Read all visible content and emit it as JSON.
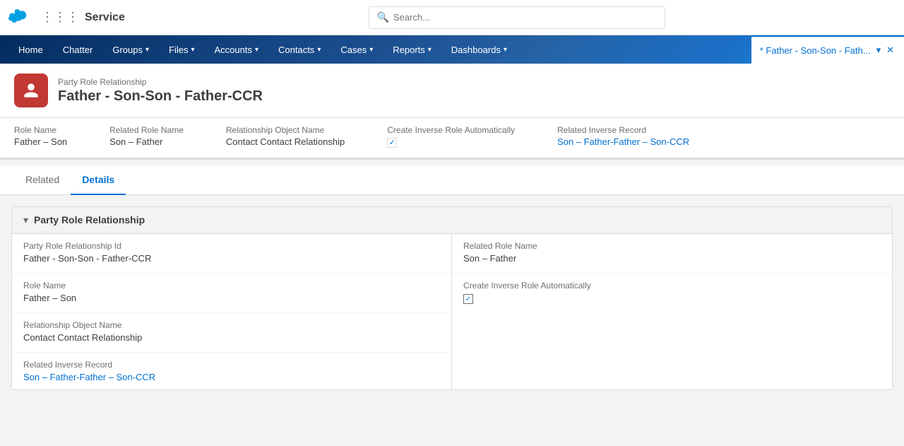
{
  "topNav": {
    "appName": "Service",
    "search": {
      "placeholder": "Search..."
    }
  },
  "navMenu": {
    "items": [
      {
        "label": "Home",
        "hasChevron": false
      },
      {
        "label": "Chatter",
        "hasChevron": false
      },
      {
        "label": "Groups",
        "hasChevron": true
      },
      {
        "label": "Files",
        "hasChevron": true
      },
      {
        "label": "Accounts",
        "hasChevron": true
      },
      {
        "label": "Contacts",
        "hasChevron": true
      },
      {
        "label": "Cases",
        "hasChevron": true
      },
      {
        "label": "Reports",
        "hasChevron": true
      },
      {
        "label": "Dashboards",
        "hasChevron": true
      }
    ],
    "activeTab": "* Father - Son-Son - Fath..."
  },
  "pageHeader": {
    "breadcrumb": "Party Role Relationship",
    "title": "Father - Son-Son - Father-CCR"
  },
  "infoBar": {
    "fields": [
      {
        "label": "Role Name",
        "value": "Father – Son",
        "type": "text"
      },
      {
        "label": "Related Role Name",
        "value": "Son – Father",
        "type": "text"
      },
      {
        "label": "Relationship Object Name",
        "value": "Contact Contact Relationship",
        "type": "text"
      },
      {
        "label": "Create Inverse Role Automatically",
        "value": "checked",
        "type": "checkbox"
      },
      {
        "label": "Related Inverse Record",
        "value": "Son – Father-Father – Son-CCR",
        "type": "link"
      }
    ]
  },
  "tabs": [
    {
      "label": "Related",
      "active": false
    },
    {
      "label": "Details",
      "active": true
    }
  ],
  "section": {
    "title": "Party Role Relationship",
    "fields": [
      {
        "label": "Party Role Relationship Id",
        "value": "Father - Son-Son - Father-CCR",
        "type": "text",
        "editable": false,
        "column": "left"
      },
      {
        "label": "Related Role Name",
        "value": "Son – Father",
        "type": "text",
        "editable": true,
        "column": "right"
      },
      {
        "label": "Role Name",
        "value": "Father – Son",
        "type": "text",
        "editable": true,
        "column": "left"
      },
      {
        "label": "Create Inverse Role Automatically",
        "value": "checked",
        "type": "checkbox",
        "editable": false,
        "column": "right"
      },
      {
        "label": "Relationship Object Name",
        "value": "Contact Contact Relationship",
        "type": "text",
        "editable": true,
        "column": "left"
      },
      {
        "label": "Related Inverse Record",
        "value": "Son – Father-Father – Son-CCR",
        "type": "link",
        "editable": true,
        "column": "left"
      }
    ]
  }
}
